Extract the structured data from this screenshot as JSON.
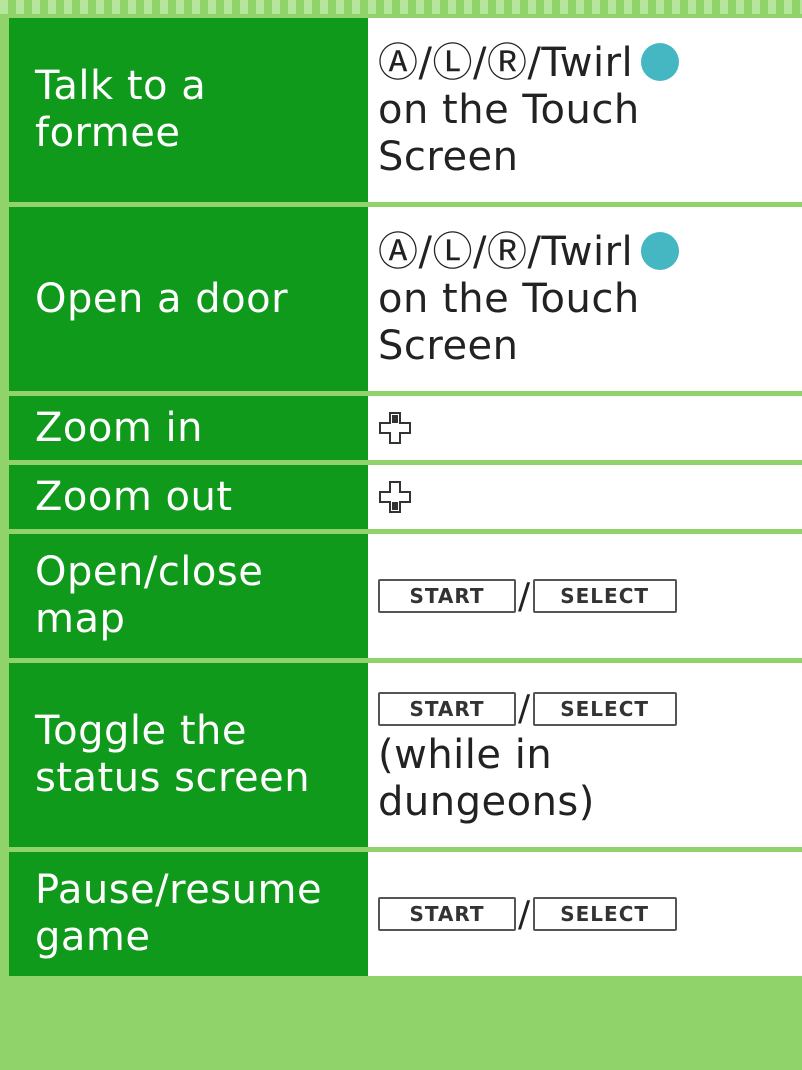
{
  "rows": [
    {
      "label": "Talk to a\nformee",
      "value_text": "Ⓐ/Ⓛ/Ⓡ/Twirl",
      "value_suffix": "on the Touch\nScreen",
      "icon": "stylus-dot"
    },
    {
      "label": "Open a door",
      "value_text": "Ⓐ/Ⓛ/Ⓡ/Twirl",
      "value_suffix": "on the Touch\nScreen",
      "icon": "stylus-dot"
    },
    {
      "label": "Zoom in",
      "icon": "dpad-up-icon"
    },
    {
      "label": "Zoom out",
      "icon": "dpad-down-icon"
    },
    {
      "label": "Open/close\nmap",
      "start": "START",
      "sep": "/",
      "select": "SELECT"
    },
    {
      "label": "Toggle the\nstatus screen",
      "start": "START",
      "sep": "/",
      "select": "SELECT",
      "value_suffix": "(while in\ndungeons)"
    },
    {
      "label": "Pause/resume\ngame",
      "start": "START",
      "sep": "/",
      "select": "SELECT"
    }
  ],
  "colors": {
    "label_bg": "#0f9a1c",
    "page_bg": "#8fd36a",
    "dot": "#45b7c2"
  }
}
